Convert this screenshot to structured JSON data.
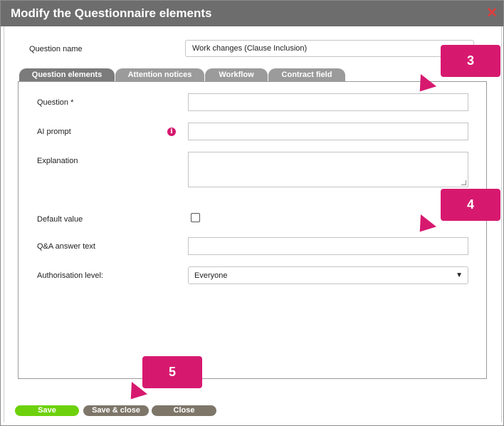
{
  "dialog": {
    "title": "Modify the Questionnaire elements"
  },
  "question_name": {
    "label": "Question name",
    "value": "Work changes (Clause Inclusion)"
  },
  "tabs": [
    {
      "label": "Question elements",
      "active": true
    },
    {
      "label": "Attention notices",
      "active": false
    },
    {
      "label": "Workflow",
      "active": false
    },
    {
      "label": "Contract field",
      "active": false
    }
  ],
  "form": {
    "question_label": "Question *",
    "ai_prompt_label": "AI prompt",
    "explanation_label": "Explanation",
    "default_value_label": "Default value",
    "qa_answer_label": "Q&A answer text",
    "authorisation_label": "Authorisation level:",
    "authorisation_value": "Everyone"
  },
  "buttons": {
    "save": "Save",
    "save_close": "Save & close",
    "close": "Close"
  },
  "callouts": [
    "3",
    "4",
    "5"
  ],
  "colors": {
    "accent": "#d6196f",
    "save": "#6dd10a",
    "neutral_button": "#7d7669",
    "titlebar": "#6d6d6d"
  }
}
